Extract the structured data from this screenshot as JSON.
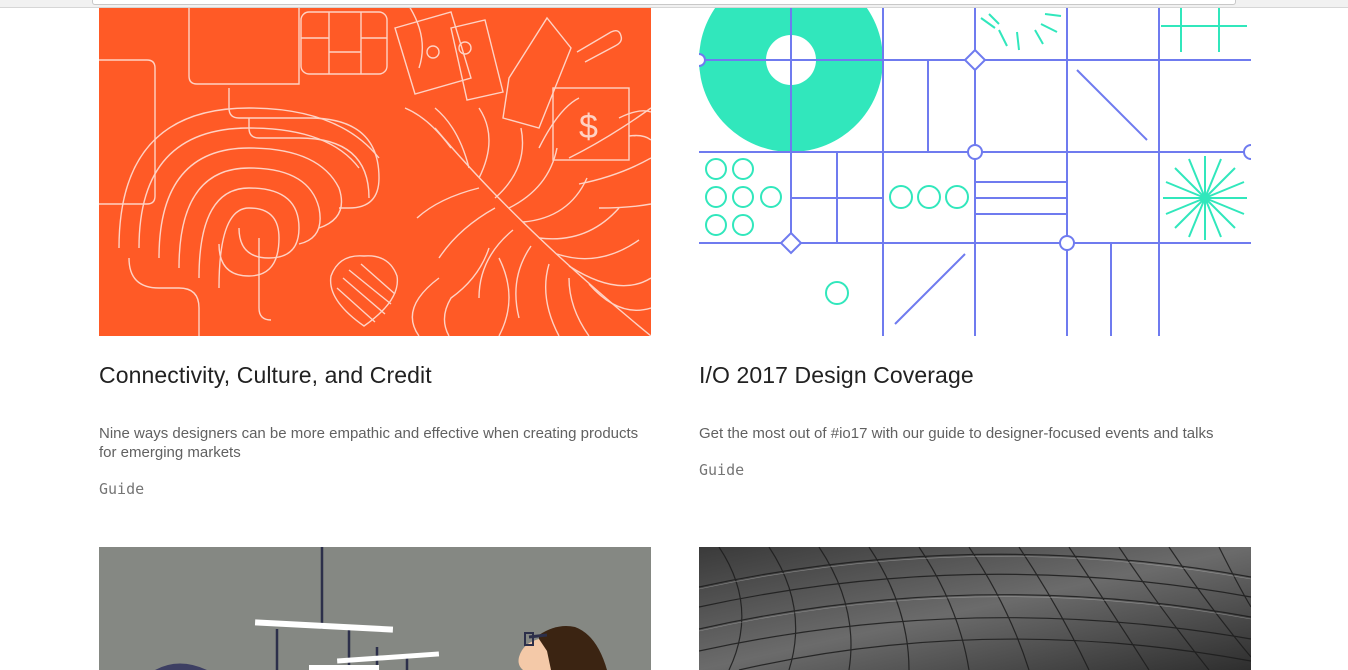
{
  "cards": [
    {
      "title": "Connectivity, Culture, and Credit",
      "description": "Nine ways designers can be more empathic and effective when creating products for emerging markets",
      "tag": "Guide",
      "image_icon": "fern-heart-fingerprint-illustration"
    },
    {
      "title": "I/O 2017 Design Coverage",
      "description": "Get the most out of #io17 with our guide to designer-focused events and talks",
      "tag": "Guide",
      "image_icon": "geometric-grid-illustration"
    },
    {
      "image_icon": "mobile-and-person-illustration"
    },
    {
      "image_icon": "curved-tiled-ceiling-photo"
    }
  ],
  "colors": {
    "orange": "#FF5A26",
    "grid_blue": "#6F7BEF",
    "mint": "#31E7BC",
    "gray_bg": "#858883"
  }
}
